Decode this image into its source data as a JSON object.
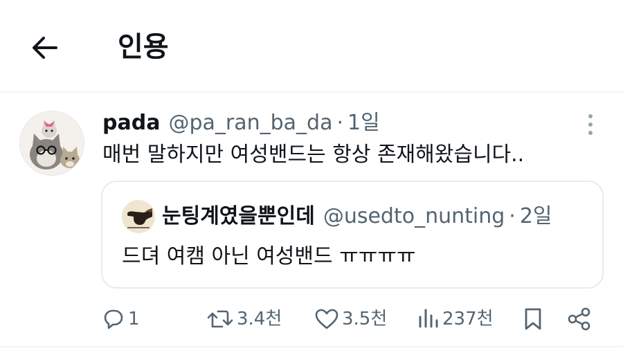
{
  "header": {
    "back_icon": "arrow-left-icon",
    "title": "인용"
  },
  "tweet": {
    "display_name": "pada",
    "handle": "@pa_ran_ba_da",
    "separator": "·",
    "time": "1일",
    "text": "매번 말하지만 여성밴드는 항상 존재해왔습니다..",
    "more_icon": "more-vertical-icon",
    "avatar_icon": "cat-avatar-icon"
  },
  "quote": {
    "display_name": "눈팅계였을뿐인데",
    "handle": "@usedto_nunting",
    "separator": "·",
    "time": "2일",
    "text": "드뎌 여캠 아닌 여성밴드 ㅠㅠㅠㅠ",
    "avatar_icon": "pipe-painting-avatar-icon"
  },
  "actions": {
    "reply": {
      "icon": "reply-icon",
      "count": "1"
    },
    "retweet": {
      "icon": "retweet-icon",
      "count": "3.4천"
    },
    "like": {
      "icon": "heart-icon",
      "count": "3.5천"
    },
    "views": {
      "icon": "views-chart-icon",
      "count": "237천"
    },
    "bookmark": {
      "icon": "bookmark-icon"
    },
    "share": {
      "icon": "share-icon"
    }
  },
  "colors": {
    "text_primary": "#0f1419",
    "text_secondary": "#536471",
    "divider": "#eff3f4",
    "card_border": "#e6ebee"
  }
}
